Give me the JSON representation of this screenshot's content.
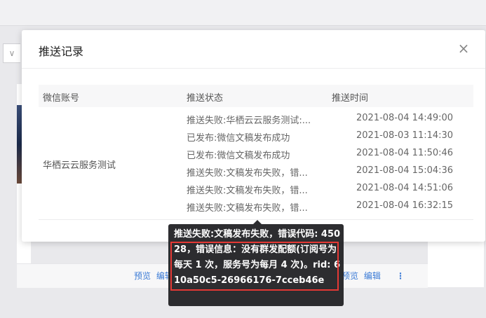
{
  "background": {
    "select_chevron": "∨",
    "footer": {
      "preview": "预览",
      "edit": "编辑"
    }
  },
  "modal": {
    "title": "推送记录",
    "close_icon": "×",
    "columns": {
      "account": "微信账号",
      "status": "推送状态",
      "time": "推送时间"
    },
    "account": "华栖云云服务测试",
    "rows": [
      {
        "status": "推送失败:华栖云云服务测试:...",
        "time": "2021-08-04 14:49:00"
      },
      {
        "status": "已发布:微信文稿发布成功",
        "time": "2021-08-03 11:14:30"
      },
      {
        "status": "已发布:微信文稿发布成功",
        "time": "2021-08-04 11:50:46"
      },
      {
        "status": "推送失败:文稿发布失败，错...",
        "time": "2021-08-04 15:04:36"
      },
      {
        "status": "推送失败:文稿发布失败，错...",
        "time": "2021-08-04 14:51:06"
      },
      {
        "status": "推送失败:文稿发布失败，错...",
        "time": "2021-08-04 16:32:15"
      }
    ]
  },
  "tooltip": {
    "text": "推送失败:文稿发布失败，错误代码: 45028，错误信息：没有群发配额(订阅号为每天 1 次，服务号为每月 4 次)。rid: 610a50c5-26966176-7cceb46e"
  },
  "colors": {
    "link": "#3b7bd6",
    "highlight": "#e53935",
    "tooltip_bg": "#222225"
  }
}
